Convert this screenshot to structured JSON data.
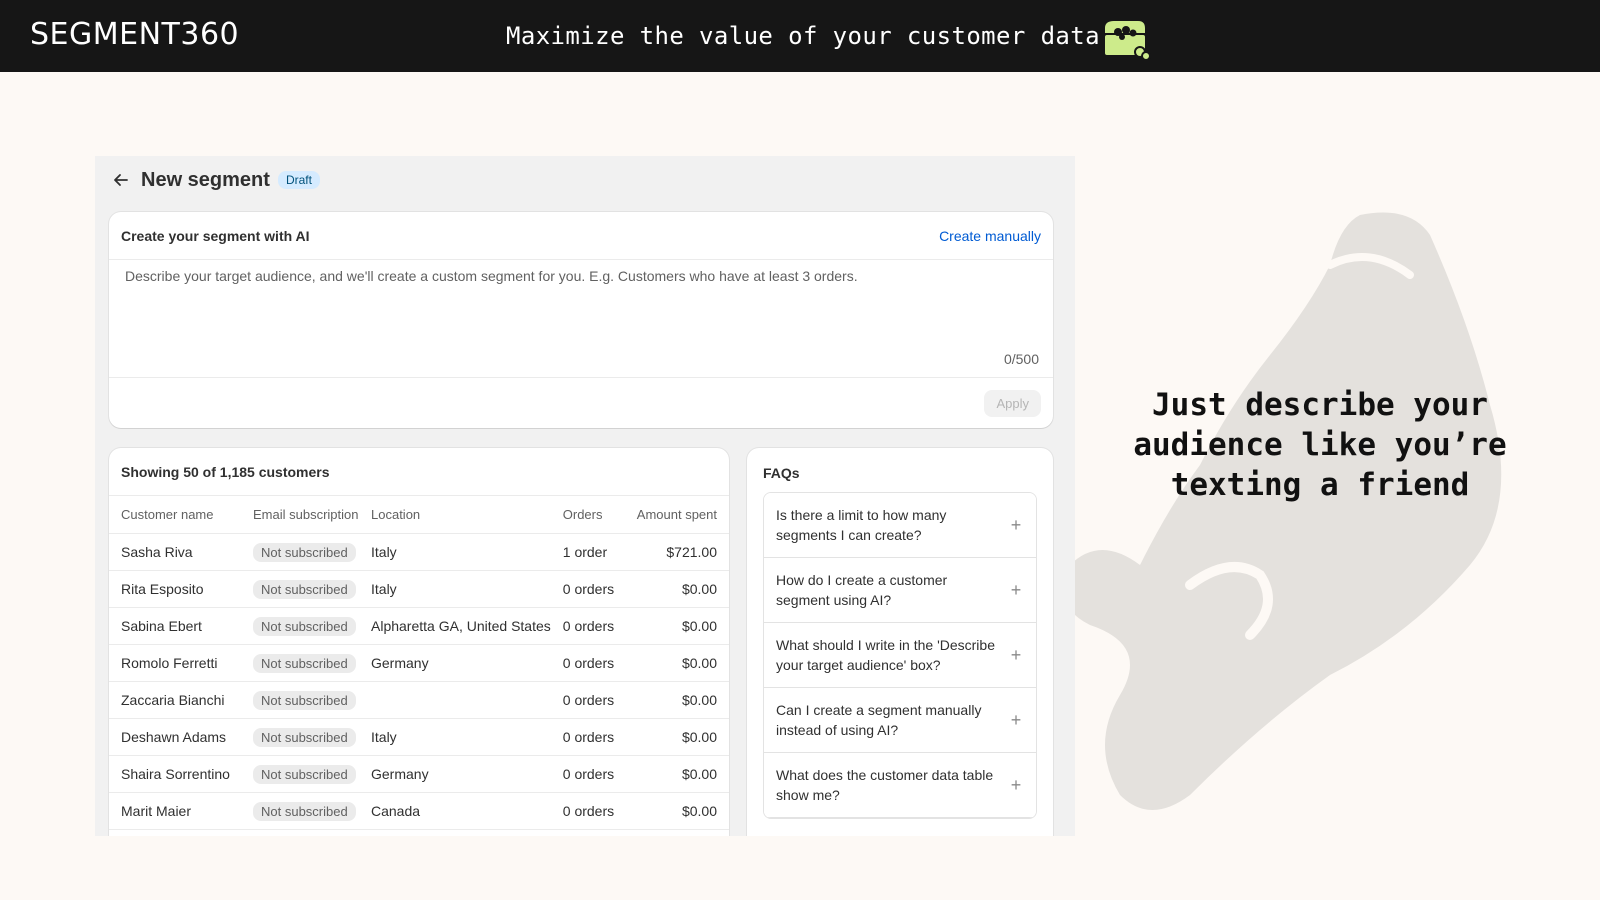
{
  "header": {
    "brand": "SEGMENT360",
    "tagline": "Maximize the value of your customer data",
    "icon": "treasure-chest-icon"
  },
  "hero": {
    "line1": "Just describe your",
    "line2": "audience like you’re",
    "line3": "texting a friend"
  },
  "page": {
    "title": "New segment",
    "badge": "Draft"
  },
  "ai": {
    "title": "Create your segment with AI",
    "create_manually": "Create manually",
    "placeholder": "Describe your target audience, and we'll create a custom segment for you. E.g. Customers who have at least 3 orders.",
    "counter": "0/500",
    "apply": "Apply"
  },
  "table": {
    "title": "Showing 50 of 1,185 customers",
    "columns": [
      "Customer name",
      "Email subscription",
      "Location",
      "Orders",
      "Amount spent"
    ],
    "rows": [
      {
        "name": "Sasha Riva",
        "email": "Not subscribed",
        "location": "Italy",
        "orders": "1 order",
        "amount": "$721.00"
      },
      {
        "name": "Rita Esposito",
        "email": "Not subscribed",
        "location": "Italy",
        "orders": "0 orders",
        "amount": "$0.00"
      },
      {
        "name": "Sabina Ebert",
        "email": "Not subscribed",
        "location": "Alpharetta GA, United States",
        "orders": "0 orders",
        "amount": "$0.00"
      },
      {
        "name": "Romolo Ferretti",
        "email": "Not subscribed",
        "location": "Germany",
        "orders": "0 orders",
        "amount": "$0.00"
      },
      {
        "name": "Zaccaria Bianchi",
        "email": "Not subscribed",
        "location": "",
        "orders": "0 orders",
        "amount": "$0.00"
      },
      {
        "name": "Deshawn Adams",
        "email": "Not subscribed",
        "location": "Italy",
        "orders": "0 orders",
        "amount": "$0.00"
      },
      {
        "name": "Shaira Sorrentino",
        "email": "Not subscribed",
        "location": "Germany",
        "orders": "0 orders",
        "amount": "$0.00"
      },
      {
        "name": "Marit Maier",
        "email": "Not subscribed",
        "location": "Canada",
        "orders": "0 orders",
        "amount": "$0.00"
      }
    ]
  },
  "faqs": {
    "title": "FAQs",
    "items": [
      "Is there a limit to how many segments I can create?",
      "How do I create a customer segment using AI?",
      "What should I write in the 'Describe your target audience' box?",
      "Can I create a segment manually instead of using AI?",
      "What does the customer data table show me?"
    ]
  },
  "colors": {
    "topbar": "#161616",
    "accent_link": "#005bd3",
    "badge_bg": "#d5ebff",
    "chest": "#cdeb8b",
    "hero_shape": "#e4e1dd"
  }
}
